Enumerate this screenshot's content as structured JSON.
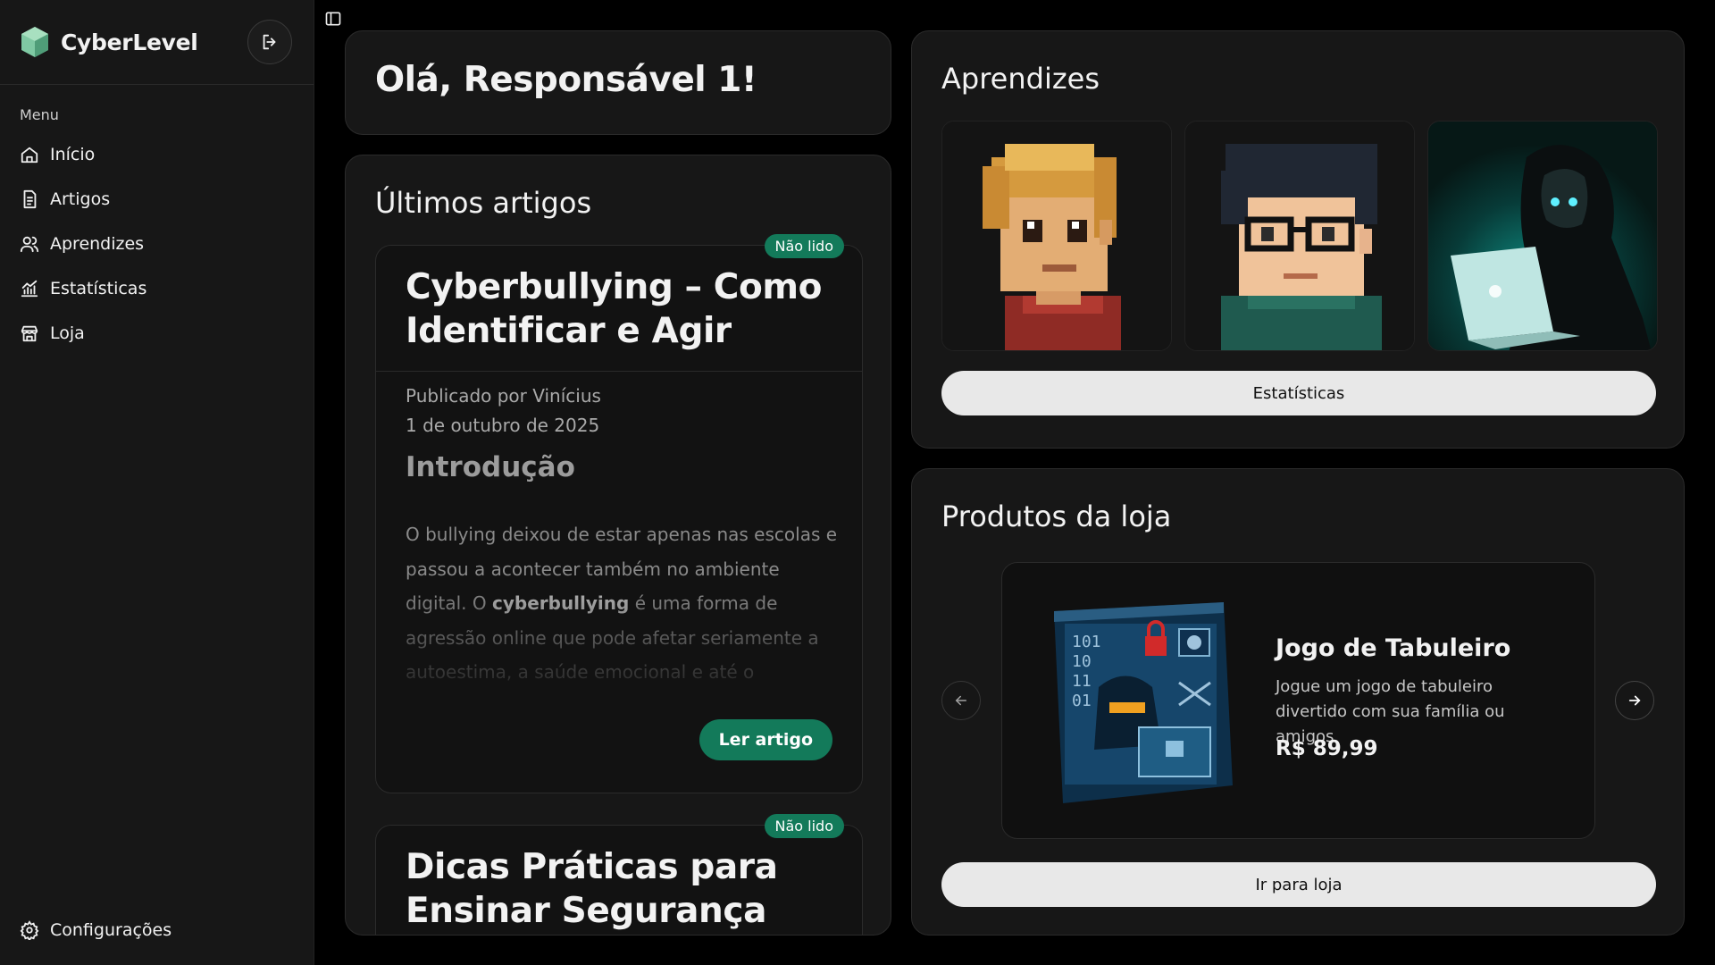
{
  "brand": {
    "name": "CyberLevel"
  },
  "sidebar": {
    "menu_label": "Menu",
    "items": [
      {
        "label": "Início",
        "icon": "home-icon"
      },
      {
        "label": "Artigos",
        "icon": "document-icon"
      },
      {
        "label": "Aprendizes",
        "icon": "users-icon"
      },
      {
        "label": "Estatísticas",
        "icon": "chart-icon"
      },
      {
        "label": "Loja",
        "icon": "store-icon"
      }
    ],
    "settings_label": "Configurações"
  },
  "greeting": {
    "text": "Olá, Responsável 1!"
  },
  "articles": {
    "title": "Últimos artigos",
    "items": [
      {
        "badge": "Não lido",
        "title": "Cyberbullying – Como Identificar e Agir",
        "author": "Publicado por Vinícius",
        "date": "1 de outubro de 2025",
        "heading": "Introdução",
        "body_before": "O bullying deixou de estar apenas nas escolas e passou a acontecer também no ambiente digital. O ",
        "body_bold": "cyberbullying",
        "body_after": " é uma forma de agressão online que pode afetar seriamente a autoestima, a saúde emocional e até o desempenho escolar das crianças e adolescentes.",
        "read_label": "Ler artigo"
      },
      {
        "badge": "Não lido",
        "title": "Dicas Práticas para Ensinar Segurança"
      }
    ]
  },
  "learners": {
    "title": "Aprendizes",
    "stats_label": "Estatísticas"
  },
  "shop": {
    "title": "Produtos da loja",
    "product": {
      "name": "Jogo de Tabuleiro",
      "description": "Jogue um jogo de tabuleiro divertido com sua família ou amigos",
      "price": "R$ 89,99",
      "img_text": [
        "101",
        "10",
        "11",
        "01"
      ]
    },
    "go_label": "Ir para loja"
  },
  "colors": {
    "accent": "#137a5a",
    "card": "#171717",
    "background": "#000000"
  }
}
